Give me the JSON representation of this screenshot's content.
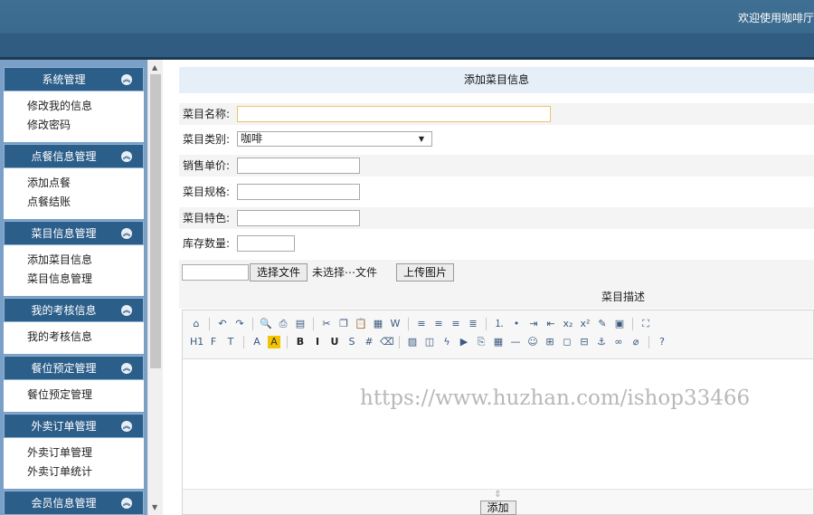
{
  "header": {
    "welcome": "欢迎使用咖啡厅"
  },
  "sidebar": {
    "groups": [
      {
        "title": "系统管理",
        "items": [
          "修改我的信息",
          "修改密码"
        ]
      },
      {
        "title": "点餐信息管理",
        "items": [
          "添加点餐",
          "点餐结账"
        ]
      },
      {
        "title": "菜目信息管理",
        "items": [
          "添加菜目信息",
          "菜目信息管理"
        ]
      },
      {
        "title": "我的考核信息",
        "items": [
          "我的考核信息"
        ]
      },
      {
        "title": "餐位预定管理",
        "items": [
          "餐位预定管理"
        ]
      },
      {
        "title": "外卖订单管理",
        "items": [
          "外卖订单管理",
          "外卖订单统计"
        ]
      },
      {
        "title": "会员信息管理",
        "items": []
      }
    ]
  },
  "form": {
    "title": "添加菜目信息",
    "name_label": "菜目名称:",
    "name_value": "",
    "type_label": "菜目类别:",
    "type_value": "咖啡",
    "price_label": "销售单价:",
    "price_value": "",
    "spec_label": "菜目规格:",
    "spec_value": "",
    "feature_label": "菜目特色:",
    "feature_value": "",
    "stock_label": "库存数量:",
    "stock_value": "",
    "choose_file_button": "选择文件",
    "no_file_text": "未选择⋯文件",
    "upload_button": "上传图片",
    "description_label": "菜目描述",
    "add_button": "添加"
  },
  "editor": {
    "watermark": "https://www.huzhan.com/ishop33466",
    "row1_icons": [
      "source-icon",
      "undo-icon",
      "redo-icon",
      "preview-icon",
      "print-icon",
      "template-icon",
      "cut-icon",
      "copy-icon",
      "paste-icon",
      "paste-text-icon",
      "paste-word-icon",
      "align-left-icon",
      "align-center-icon",
      "align-right-icon",
      "justify-icon",
      "ordered-list-icon",
      "unordered-list-icon",
      "indent-icon",
      "outdent-icon",
      "subscript-icon",
      "superscript-icon",
      "clear-format-icon",
      "select-all-icon",
      "fullscreen-icon"
    ],
    "row2_icons": [
      "heading-icon",
      "font-family-icon",
      "font-size-icon",
      "font-color-icon",
      "highlight-icon",
      "bold-icon",
      "italic-icon",
      "underline-icon",
      "strikethrough-icon",
      "line-height-icon",
      "remove-format-icon",
      "image-icon",
      "multi-image-icon",
      "flash-icon",
      "media-icon",
      "attachment-icon",
      "table-icon",
      "hr-icon",
      "emoticon-icon",
      "map-icon",
      "code-icon",
      "page-break-icon",
      "anchor-icon",
      "link-icon",
      "unlink-icon",
      "help-icon"
    ]
  }
}
